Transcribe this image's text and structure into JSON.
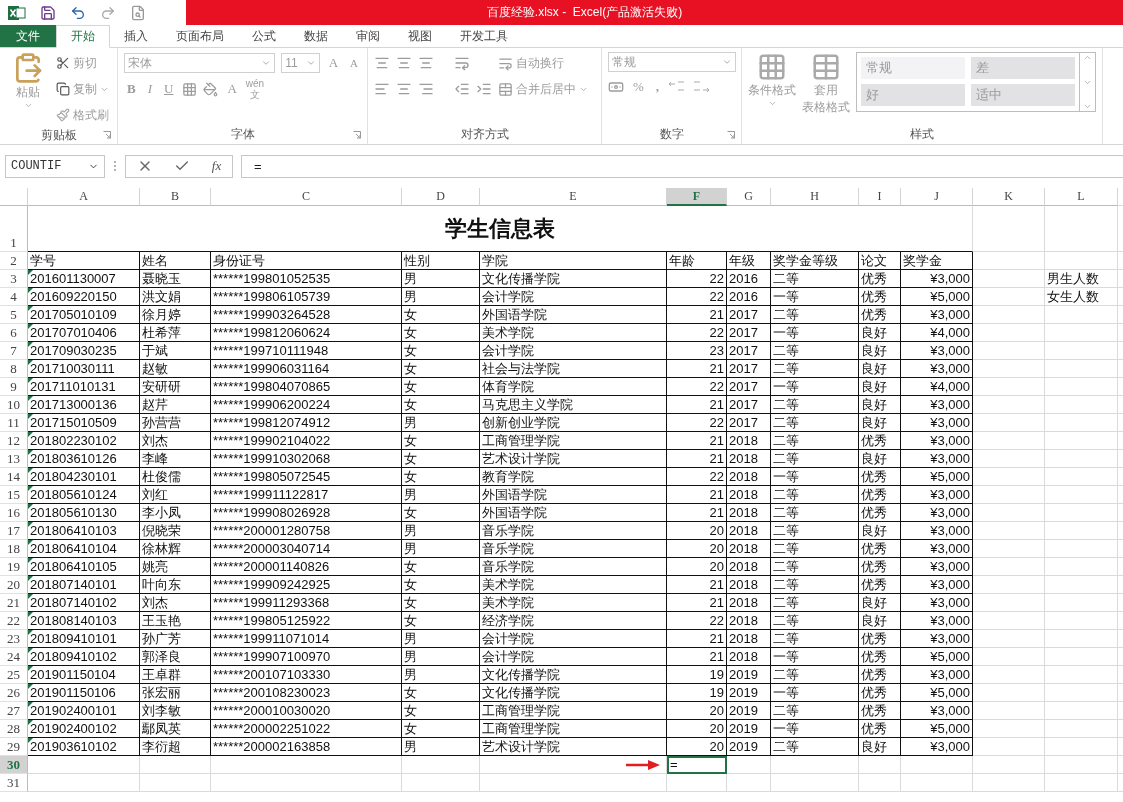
{
  "window": {
    "title": "百度经验.xlsx -  Excel(产品激活失败)"
  },
  "ribbon_tabs": [
    {
      "label": "文件",
      "kind": "file",
      "selected": false
    },
    {
      "label": "开始",
      "kind": "tab",
      "selected": true
    },
    {
      "label": "插入",
      "kind": "tab",
      "selected": false
    },
    {
      "label": "页面布局",
      "kind": "tab",
      "selected": false
    },
    {
      "label": "公式",
      "kind": "tab",
      "selected": false
    },
    {
      "label": "数据",
      "kind": "tab",
      "selected": false
    },
    {
      "label": "审阅",
      "kind": "tab",
      "selected": false
    },
    {
      "label": "视图",
      "kind": "tab",
      "selected": false
    },
    {
      "label": "开发工具",
      "kind": "tab",
      "selected": false
    }
  ],
  "ribbon": {
    "disabled": true,
    "groups": [
      {
        "kind": "clipboard",
        "label": "剪贴板",
        "paste": "粘贴",
        "cut": "剪切",
        "copy": "复制",
        "format_painter": "格式刷"
      },
      {
        "kind": "font",
        "label": "字体",
        "font_name": "宋体",
        "font_size": "11",
        "grow": "A",
        "shrink": "A",
        "bold": "B",
        "italic": "I",
        "underline": "U",
        "font_color": "A",
        "phonetic_top": "wén",
        "phonetic_bottom": "文"
      },
      {
        "kind": "alignment",
        "label": "对齐方式",
        "wrap": "自动换行",
        "merge": "合并后居中"
      },
      {
        "kind": "number",
        "label": "数字",
        "format": "常规",
        "percent": "%",
        "comma": ","
      },
      {
        "kind": "styles",
        "label": "样式",
        "conditional": "条件格式",
        "table_top": "套用",
        "table_bottom": "表格格式",
        "cells": [
          {
            "label": "常规",
            "kind": "normal"
          },
          {
            "label": "差",
            "kind": "bad"
          },
          {
            "label": "好",
            "kind": "good"
          },
          {
            "label": "适中",
            "kind": "neutral"
          }
        ]
      }
    ]
  },
  "formula_bar": {
    "name_box": "COUNTIF",
    "fx": "fx",
    "formula": "="
  },
  "sheet": {
    "columns": [
      {
        "label": "A",
        "selected": false
      },
      {
        "label": "B",
        "selected": false
      },
      {
        "label": "C",
        "selected": false
      },
      {
        "label": "D",
        "selected": false
      },
      {
        "label": "E",
        "selected": false
      },
      {
        "label": "F",
        "selected": true
      },
      {
        "label": "G",
        "selected": false
      },
      {
        "label": "H",
        "selected": false
      },
      {
        "label": "I",
        "selected": false
      },
      {
        "label": "J",
        "selected": false
      },
      {
        "label": "K",
        "selected": false
      },
      {
        "label": "L",
        "selected": false
      }
    ],
    "title": "学生信息表",
    "headers": [
      "学号",
      "姓名",
      "身份证号",
      "性别",
      "学院",
      "年龄",
      "年级",
      "奖学金等级",
      "论文",
      "奖学金"
    ],
    "rows": [
      {
        "row": "3",
        "cells": [
          "201601130007",
          "聂晓玉",
          "******199801052535",
          "男",
          "文化传播学院",
          "22",
          "2016",
          "二等",
          "优秀",
          "¥3,000"
        ],
        "side": "男生人数"
      },
      {
        "row": "4",
        "cells": [
          "201609220150",
          "洪文娟",
          "******199806105739",
          "男",
          "会计学院",
          "22",
          "2016",
          "一等",
          "优秀",
          "¥5,000"
        ],
        "side": "女生人数"
      },
      {
        "row": "5",
        "cells": [
          "201705010109",
          "徐月婷",
          "******199903264528",
          "女",
          "外国语学院",
          "21",
          "2017",
          "二等",
          "优秀",
          "¥3,000"
        ]
      },
      {
        "row": "6",
        "cells": [
          "201707010406",
          "杜希萍",
          "******199812060624",
          "女",
          "美术学院",
          "22",
          "2017",
          "一等",
          "良好",
          "¥4,000"
        ]
      },
      {
        "row": "7",
        "cells": [
          "201709030235",
          "于斌",
          "******199710111948",
          "女",
          "会计学院",
          "23",
          "2017",
          "二等",
          "良好",
          "¥3,000"
        ]
      },
      {
        "row": "8",
        "cells": [
          "201710030111",
          "赵敏",
          "******199906031164",
          "女",
          "社会与法学院",
          "21",
          "2017",
          "二等",
          "良好",
          "¥3,000"
        ]
      },
      {
        "row": "9",
        "cells": [
          "201711010131",
          "安研研",
          "******199804070865",
          "女",
          "体育学院",
          "22",
          "2017",
          "一等",
          "良好",
          "¥4,000"
        ]
      },
      {
        "row": "10",
        "cells": [
          "201713000136",
          "赵芹",
          "******199906200224",
          "女",
          "马克思主义学院",
          "21",
          "2017",
          "二等",
          "良好",
          "¥3,000"
        ]
      },
      {
        "row": "11",
        "cells": [
          "201715010509",
          "孙营营",
          "******199812074912",
          "男",
          "创新创业学院",
          "22",
          "2017",
          "二等",
          "良好",
          "¥3,000"
        ]
      },
      {
        "row": "12",
        "cells": [
          "201802230102",
          "刘杰",
          "******199902104022",
          "女",
          "工商管理学院",
          "21",
          "2018",
          "二等",
          "优秀",
          "¥3,000"
        ]
      },
      {
        "row": "13",
        "cells": [
          "201803610126",
          "李峰",
          "******199910302068",
          "女",
          "艺术设计学院",
          "21",
          "2018",
          "二等",
          "良好",
          "¥3,000"
        ]
      },
      {
        "row": "14",
        "cells": [
          "201804230101",
          "杜俊儒",
          "******199805072545",
          "女",
          "教育学院",
          "22",
          "2018",
          "一等",
          "优秀",
          "¥5,000"
        ]
      },
      {
        "row": "15",
        "cells": [
          "201805610124",
          "刘红",
          "******199911122817",
          "男",
          "外国语学院",
          "21",
          "2018",
          "二等",
          "优秀",
          "¥3,000"
        ]
      },
      {
        "row": "16",
        "cells": [
          "201805610130",
          "李小凤",
          "******199908026928",
          "女",
          "外国语学院",
          "21",
          "2018",
          "二等",
          "优秀",
          "¥3,000"
        ]
      },
      {
        "row": "17",
        "cells": [
          "201806410103",
          "倪晓荣",
          "******200001280758",
          "男",
          "音乐学院",
          "20",
          "2018",
          "二等",
          "良好",
          "¥3,000"
        ]
      },
      {
        "row": "18",
        "cells": [
          "201806410104",
          "徐林辉",
          "******200003040714",
          "男",
          "音乐学院",
          "20",
          "2018",
          "二等",
          "优秀",
          "¥3,000"
        ]
      },
      {
        "row": "19",
        "cells": [
          "201806410105",
          "姚亮",
          "******200001140826",
          "女",
          "音乐学院",
          "20",
          "2018",
          "二等",
          "优秀",
          "¥3,000"
        ]
      },
      {
        "row": "20",
        "cells": [
          "201807140101",
          "叶向东",
          "******199909242925",
          "女",
          "美术学院",
          "21",
          "2018",
          "二等",
          "优秀",
          "¥3,000"
        ]
      },
      {
        "row": "21",
        "cells": [
          "201807140102",
          "刘杰",
          "******199911293368",
          "女",
          "美术学院",
          "21",
          "2018",
          "二等",
          "良好",
          "¥3,000"
        ]
      },
      {
        "row": "22",
        "cells": [
          "201808140103",
          "王玉艳",
          "******199805125922",
          "女",
          "经济学院",
          "22",
          "2018",
          "二等",
          "良好",
          "¥3,000"
        ]
      },
      {
        "row": "23",
        "cells": [
          "201809410101",
          "孙广芳",
          "******199911071014",
          "男",
          "会计学院",
          "21",
          "2018",
          "二等",
          "优秀",
          "¥3,000"
        ]
      },
      {
        "row": "24",
        "cells": [
          "201809410102",
          "郭泽良",
          "******199907100970",
          "男",
          "会计学院",
          "21",
          "2018",
          "一等",
          "优秀",
          "¥5,000"
        ]
      },
      {
        "row": "25",
        "cells": [
          "201901150104",
          "王卓群",
          "******200107103330",
          "男",
          "文化传播学院",
          "19",
          "2019",
          "二等",
          "优秀",
          "¥3,000"
        ]
      },
      {
        "row": "26",
        "cells": [
          "201901150106",
          "张宏丽",
          "******200108230023",
          "女",
          "文化传播学院",
          "19",
          "2019",
          "一等",
          "优秀",
          "¥5,000"
        ]
      },
      {
        "row": "27",
        "cells": [
          "201902400101",
          "刘李敏",
          "******200010030020",
          "女",
          "工商管理学院",
          "20",
          "2019",
          "二等",
          "优秀",
          "¥3,000"
        ]
      },
      {
        "row": "28",
        "cells": [
          "201902400102",
          "鄢凤英",
          "******200002251022",
          "女",
          "工商管理学院",
          "20",
          "2019",
          "一等",
          "优秀",
          "¥5,000"
        ]
      },
      {
        "row": "29",
        "cells": [
          "201903610102",
          "李衍超",
          "******200002163858",
          "男",
          "艺术设计学院",
          "20",
          "2019",
          "二等",
          "良好",
          "¥3,000"
        ]
      }
    ],
    "row_numbers": [
      {
        "label": "1",
        "selected": false
      },
      {
        "label": "2",
        "selected": false
      },
      {
        "label": "30",
        "selected": true
      },
      {
        "label": "31",
        "selected": false
      }
    ],
    "active_cell": {
      "value": "="
    }
  }
}
